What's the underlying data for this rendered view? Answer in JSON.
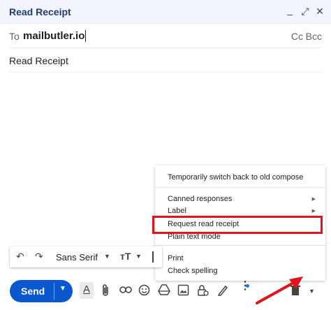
{
  "window": {
    "title": "Read Receipt",
    "minimize_glyph": "_",
    "expand_glyph": "⤢",
    "close_glyph": "✕"
  },
  "recipients": {
    "to_label": "To",
    "to_value": "mailbutler.io",
    "cc_label": "Cc",
    "bcc_label": "Bcc"
  },
  "subject": "Read Receipt",
  "more_options_menu": {
    "items": [
      {
        "label": "Temporarily switch back to old compose",
        "submenu": false
      },
      {
        "label": "Canned responses",
        "submenu": true
      },
      {
        "label": "Label",
        "submenu": true
      },
      {
        "label": "Request read receipt",
        "submenu": false,
        "highlighted": true
      },
      {
        "label": "Plain text mode",
        "submenu": false
      },
      {
        "label": "Print",
        "submenu": false
      },
      {
        "label": "Check spelling",
        "submenu": false
      }
    ]
  },
  "formatting": {
    "undo_glyph": "↶",
    "redo_glyph": "↷",
    "font_label": "Sans Serif",
    "size_glyph": "тT"
  },
  "bottom_bar": {
    "send_label": "Send",
    "icons": [
      "formatting-icon",
      "attach-icon",
      "link-icon",
      "emoji-icon",
      "drive-icon",
      "photo-icon",
      "confidential-icon",
      "signature-icon",
      "more-options-icon",
      "discard-icon",
      "dropdown-icon"
    ]
  },
  "colors": {
    "send_blue": "#0b57d0",
    "highlight_red": "#e0141c",
    "title_blue": "#1f3b6e"
  }
}
